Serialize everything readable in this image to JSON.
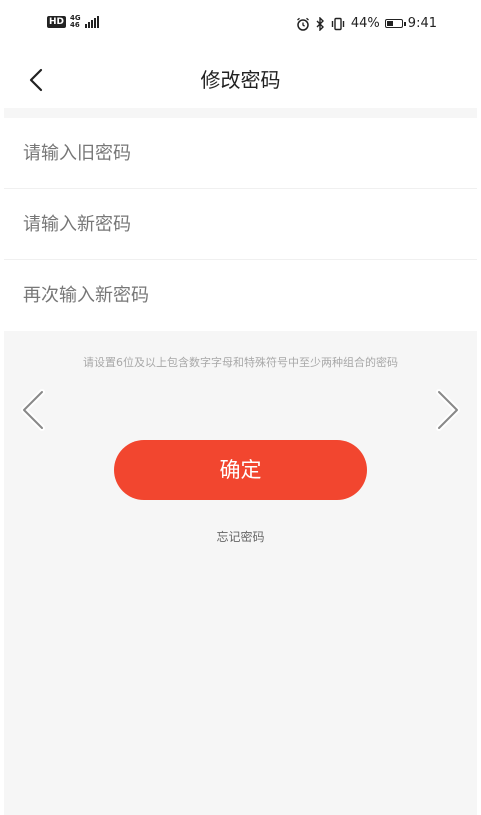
{
  "status_bar": {
    "hd_badge": "HD",
    "network": "4G",
    "network_sub": "46",
    "battery_percent": "44%",
    "battery_level": 0.44,
    "time": "9:41"
  },
  "header": {
    "title": "修改密码"
  },
  "form": {
    "old_password": {
      "placeholder": "请输入旧密码",
      "value": ""
    },
    "new_password": {
      "placeholder": "请输入新密码",
      "value": ""
    },
    "confirm_password": {
      "placeholder": "再次输入新密码",
      "value": ""
    }
  },
  "hint": "请设置6位及以上包含数字字母和特殊符号中至少两种组合的密码",
  "confirm_button": {
    "label": "确定"
  },
  "forgot_link": {
    "label": "忘记密码"
  },
  "icons": {
    "back": "chevron-left-icon",
    "prev": "chevron-left-icon",
    "next": "chevron-right-icon",
    "alarm": "alarm-icon",
    "bluetooth": "bluetooth-icon",
    "vibrate": "vibrate-icon"
  },
  "colors": {
    "accent": "#f2462f",
    "background": "#f6f6f6"
  }
}
